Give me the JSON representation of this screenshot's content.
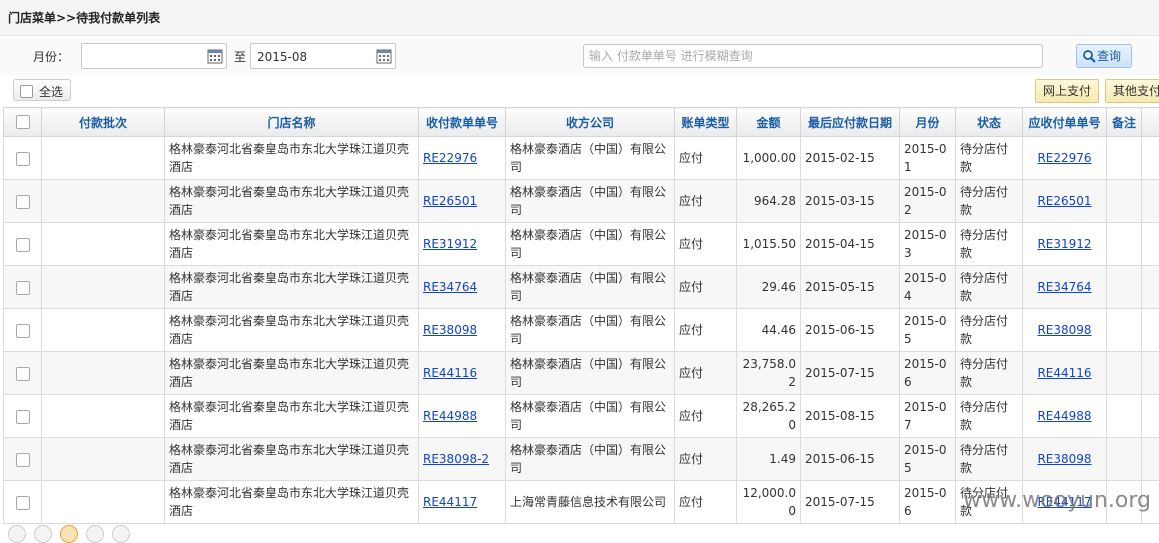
{
  "breadcrumb": "门店菜单>>待我付款单列表",
  "search": {
    "month_label": "月份：",
    "month_from": "",
    "to_label": "至",
    "month_to": "2015-08",
    "keyword_placeholder": "输入 付款单单号 进行模糊查询",
    "query_label": "查询"
  },
  "toolbar": {
    "select_all_label": "全选",
    "online_pay_label": "网上支付",
    "other_pay_label": "其他支付"
  },
  "columns": [
    "付款批次",
    "门店名称",
    "收付款单单号",
    "收方公司",
    "账单类型",
    "金额",
    "最后应付款日期",
    "月份",
    "状态",
    "应收付单单号",
    "备注"
  ],
  "rows": [
    {
      "batch": "",
      "store": "格林豪泰河北省秦皇岛市东北大学珠江道贝壳酒店",
      "bill_no": "RE22976",
      "company": "格林豪泰酒店（中国）有限公司",
      "type": "应付",
      "amount": "1,000.00",
      "due_date": "2015-02-15",
      "month": "2015-01",
      "status": "待分店付款",
      "recv_no": "RE22976",
      "remark": ""
    },
    {
      "batch": "",
      "store": "格林豪泰河北省秦皇岛市东北大学珠江道贝壳酒店",
      "bill_no": "RE26501",
      "company": "格林豪泰酒店（中国）有限公司",
      "type": "应付",
      "amount": "964.28",
      "due_date": "2015-03-15",
      "month": "2015-02",
      "status": "待分店付款",
      "recv_no": "RE26501",
      "remark": ""
    },
    {
      "batch": "",
      "store": "格林豪泰河北省秦皇岛市东北大学珠江道贝壳酒店",
      "bill_no": "RE31912",
      "company": "格林豪泰酒店（中国）有限公司",
      "type": "应付",
      "amount": "1,015.50",
      "due_date": "2015-04-15",
      "month": "2015-03",
      "status": "待分店付款",
      "recv_no": "RE31912",
      "remark": ""
    },
    {
      "batch": "",
      "store": "格林豪泰河北省秦皇岛市东北大学珠江道贝壳酒店",
      "bill_no": "RE34764",
      "company": "格林豪泰酒店（中国）有限公司",
      "type": "应付",
      "amount": "29.46",
      "due_date": "2015-05-15",
      "month": "2015-04",
      "status": "待分店付款",
      "recv_no": "RE34764",
      "remark": ""
    },
    {
      "batch": "",
      "store": "格林豪泰河北省秦皇岛市东北大学珠江道贝壳酒店",
      "bill_no": "RE38098",
      "company": "格林豪泰酒店（中国）有限公司",
      "type": "应付",
      "amount": "44.46",
      "due_date": "2015-06-15",
      "month": "2015-05",
      "status": "待分店付款",
      "recv_no": "RE38098",
      "remark": ""
    },
    {
      "batch": "",
      "store": "格林豪泰河北省秦皇岛市东北大学珠江道贝壳酒店",
      "bill_no": "RE44116",
      "company": "格林豪泰酒店（中国）有限公司",
      "type": "应付",
      "amount": "23,758.02",
      "due_date": "2015-07-15",
      "month": "2015-06",
      "status": "待分店付款",
      "recv_no": "RE44116",
      "remark": ""
    },
    {
      "batch": "",
      "store": "格林豪泰河北省秦皇岛市东北大学珠江道贝壳酒店",
      "bill_no": "RE44988",
      "company": "格林豪泰酒店（中国）有限公司",
      "type": "应付",
      "amount": "28,265.20",
      "due_date": "2015-08-15",
      "month": "2015-07",
      "status": "待分店付款",
      "recv_no": "RE44988",
      "remark": ""
    },
    {
      "batch": "",
      "store": "格林豪泰河北省秦皇岛市东北大学珠江道贝壳酒店",
      "bill_no": "RE38098-2",
      "company": "格林豪泰酒店（中国）有限公司",
      "type": "应付",
      "amount": "1.49",
      "due_date": "2015-06-15",
      "month": "2015-05",
      "status": "待分店付款",
      "recv_no": "RE38098",
      "remark": ""
    },
    {
      "batch": "",
      "store": "格林豪泰河北省秦皇岛市东北大学珠江道贝壳酒店",
      "bill_no": "RE44117",
      "company": "上海常青藤信息技术有限公司",
      "type": "应付",
      "amount": "12,000.00",
      "due_date": "2015-07-15",
      "month": "2015-06",
      "status": "待分店付款",
      "recv_no": "RE44117",
      "remark": ""
    }
  ],
  "watermark": "www.wooyun.org"
}
